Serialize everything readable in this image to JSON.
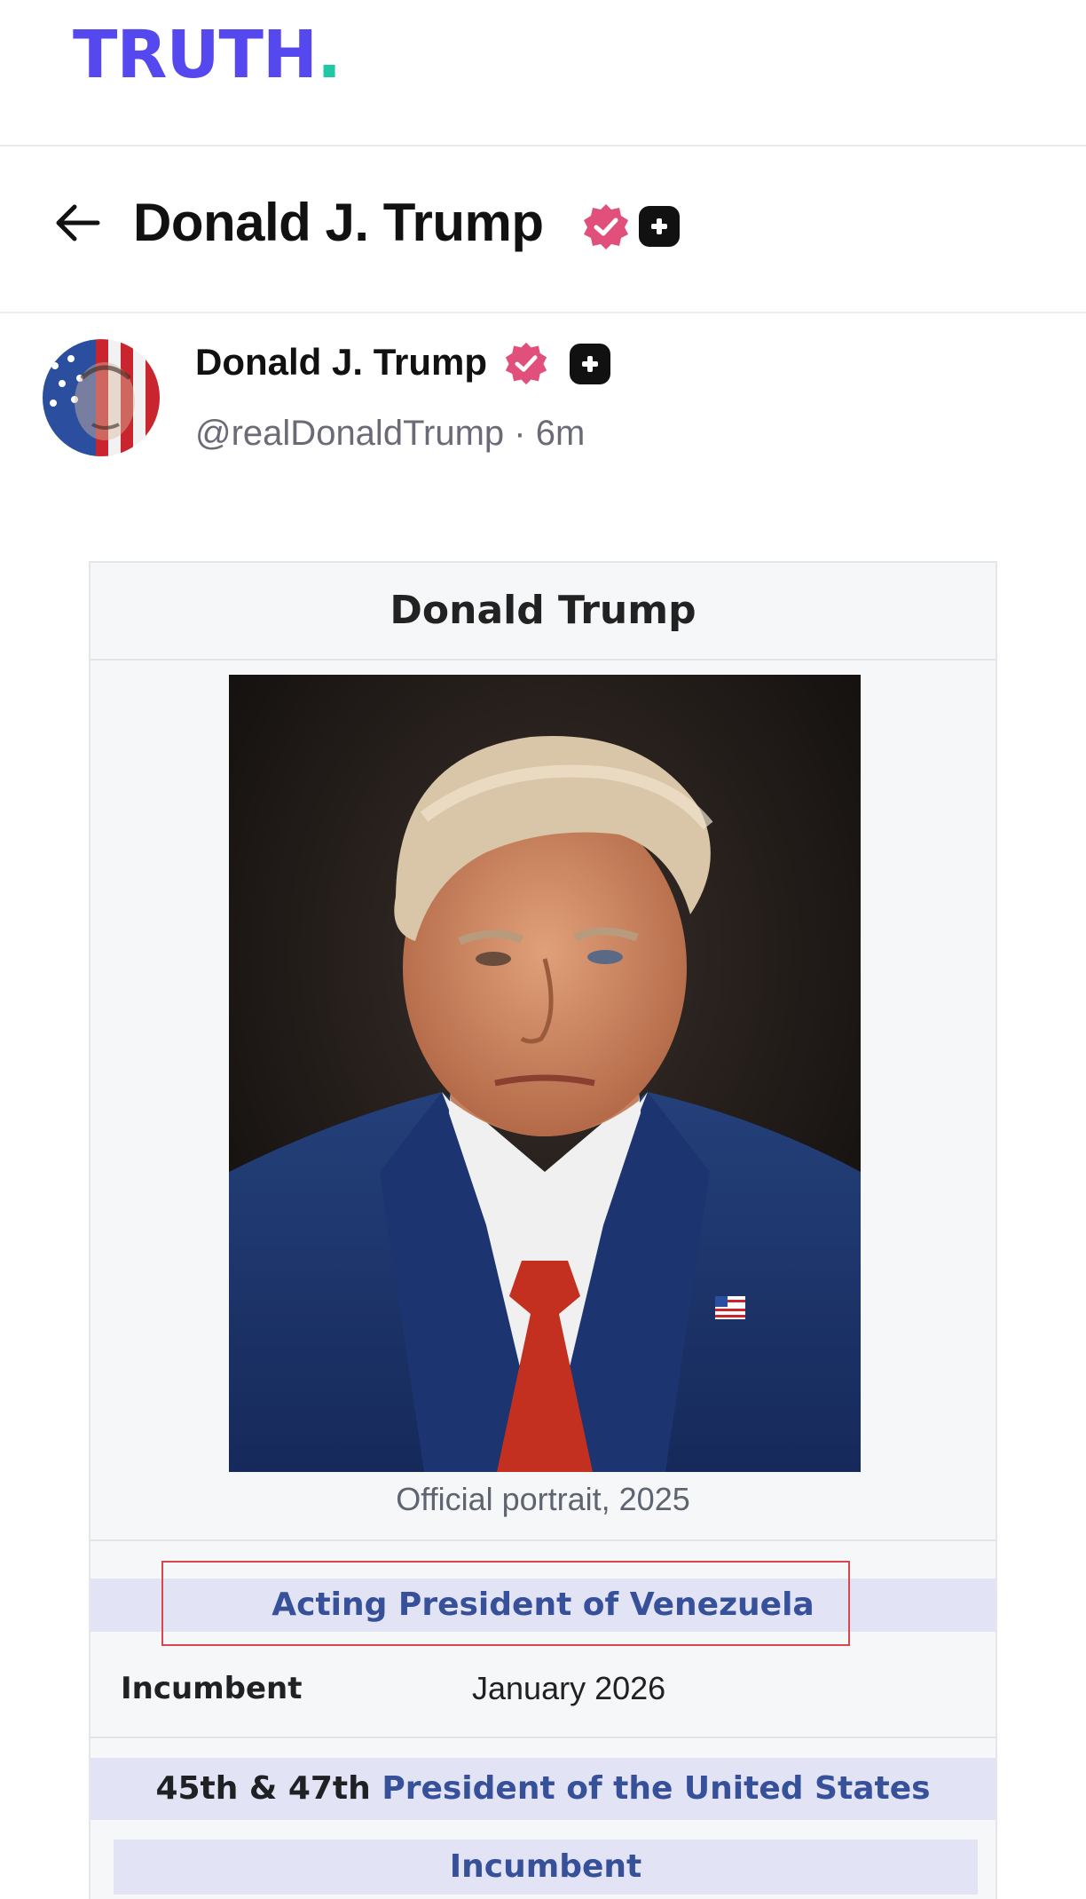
{
  "app": {
    "logo_text": "TRUTH",
    "logo_dot": ".",
    "brand_color": "#5448ee",
    "accent_color": "#22c7a9"
  },
  "profile_header": {
    "name": "Donald J. Trump",
    "back_icon": "back-arrow-icon",
    "verified_icon": "verified-badge-icon",
    "plus_icon": "plus-badge-icon"
  },
  "post": {
    "author_name": "Donald J. Trump",
    "handle": "@realDonaldTrump",
    "separator": "·",
    "time_ago": "6m"
  },
  "infobox": {
    "title": "Donald Trump",
    "image_caption": "Official portrait, 2025",
    "office1": {
      "title": "Acting President of Venezuela",
      "label": "Incumbent",
      "since": "January 2026"
    },
    "office2": {
      "ordinal": "45th & 47th",
      "title": "President of the United States",
      "status": "Incumbent"
    },
    "link_color": "#36509a",
    "highlight_color": "#d9464e"
  }
}
